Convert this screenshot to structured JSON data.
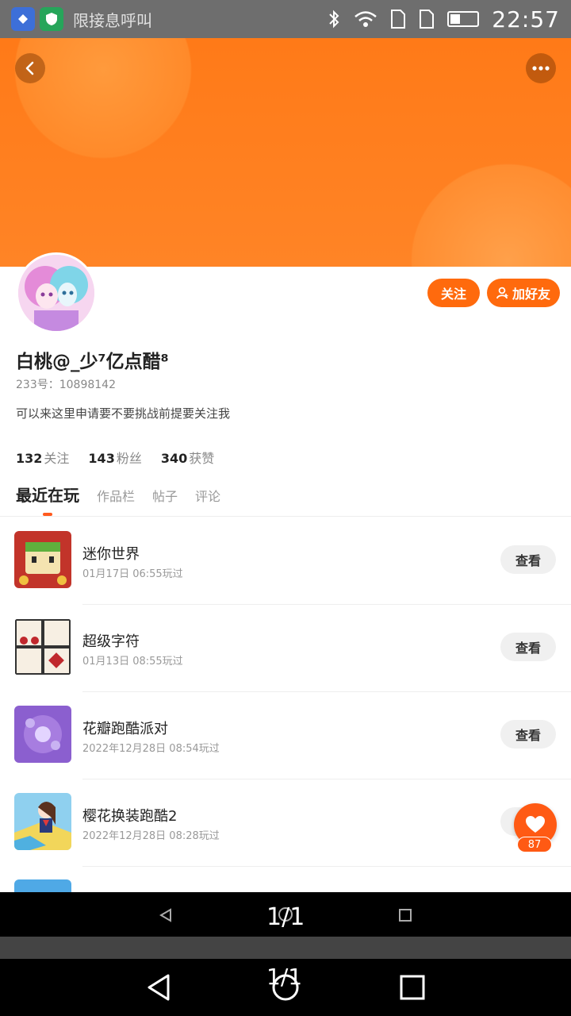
{
  "status_bar": {
    "time": "22:57",
    "notification_text": "限接息呼叫"
  },
  "profile": {
    "username": "白桃@_少⁷亿点醋⁸",
    "id_text": "233号：10898142",
    "bio": "可以来这里申请要不要挑战前提要关注我",
    "follow_label": "关注",
    "add_friend_label": "加好友",
    "stats": {
      "following_count": "132",
      "following_label": "关注",
      "fans_count": "143",
      "fans_label": "粉丝",
      "likes_count": "340",
      "likes_label": "获赞"
    }
  },
  "tabs": [
    "最近在玩",
    "作品栏",
    "帖子",
    "评论"
  ],
  "games": [
    {
      "title": "迷你世界",
      "time": "01月17日 06:55玩过",
      "button": "查看"
    },
    {
      "title": "超级字符",
      "time": "01月13日 08:55玩过",
      "button": "查看"
    },
    {
      "title": "花瓣跑酷派对",
      "time": "2022年12月28日 08:54玩过",
      "button": "查看"
    },
    {
      "title": "樱花换装跑酷2",
      "time": "2022年12月28日 08:28玩过",
      "button": "查看"
    }
  ],
  "like_count": "87",
  "page_indicator": "1/1",
  "colors": {
    "accent": "#ff6a0d",
    "banner": "#ff7a18"
  }
}
